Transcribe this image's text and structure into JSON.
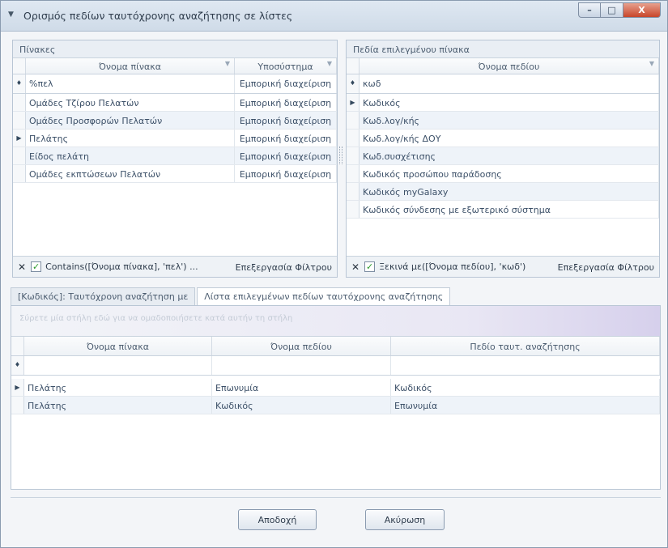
{
  "window": {
    "title": "Ορισμός πεδίων ταυτόχρονης αναζήτησης σε λίστες",
    "controls": {
      "minimize": "–",
      "maximize": "□",
      "close": "X"
    }
  },
  "tables_panel": {
    "header": "Πίνακες",
    "columns": [
      "Όνομα πίνακα",
      "Υποσύστημα"
    ],
    "filter_row": [
      "%πελ",
      "Εμπορική διαχείριση"
    ],
    "rows": [
      [
        "Ομάδες Τζίρου Πελατών",
        "Εμπορική διαχείριση"
      ],
      [
        "Ομάδες Προσφορών Πελατών",
        "Εμπορική διαχείριση"
      ],
      [
        "Πελάτης",
        "Εμπορική διαχείριση"
      ],
      [
        "Είδος πελάτη",
        "Εμπορική διαχείριση"
      ],
      [
        "Ομάδες εκπτώσεων Πελατών",
        "Εμπορική διαχείριση"
      ]
    ],
    "filter_text": "Contains([Όνομα πίνακα], 'πελ') ...",
    "filter_edit": "Επεξεργασία Φίλτρου"
  },
  "fields_panel": {
    "header": "Πεδία επιλεγμένου πίνακα",
    "columns": [
      "Όνομα πεδίου"
    ],
    "filter_row": [
      "κωδ"
    ],
    "rows": [
      [
        "Κωδικός"
      ],
      [
        "Κωδ.λογ/κής"
      ],
      [
        "Κωδ.λογ/κής ΔΟΥ"
      ],
      [
        "Κωδ.συσχέτισης"
      ],
      [
        "Κωδικός προσώπου παράδοσης"
      ],
      [
        "Κωδικός myGalaxy"
      ],
      [
        "Κωδικός σύνδεσης με εξωτερικό σύστημα"
      ]
    ],
    "filter_text": "Ξεκινά με([Όνομα πεδίου], 'κωδ')",
    "filter_edit": "Επεξεργασία Φίλτρου"
  },
  "tabs": [
    {
      "label": "[Κωδικός]: Ταυτόχρονη αναζήτηση με"
    },
    {
      "label": "Λίστα επιλεγμένων πεδίων ταυτόχρονης αναζήτησης"
    }
  ],
  "selected_grid": {
    "group_hint": "Σύρετε μία στήλη εδώ για να ομαδοποιήσετε κατά αυτήν τη στήλη",
    "columns": [
      "Όνομα πίνακα",
      "Όνομα πεδίου",
      "Πεδίο ταυτ. αναζήτησης"
    ],
    "rows": [
      [
        "Πελάτης",
        "Επωνυμία",
        "Κωδικός"
      ],
      [
        "Πελάτης",
        "Κωδικός",
        "Επωνυμία"
      ]
    ]
  },
  "buttons": {
    "ok": "Αποδοχή",
    "cancel": "Ακύρωση"
  }
}
